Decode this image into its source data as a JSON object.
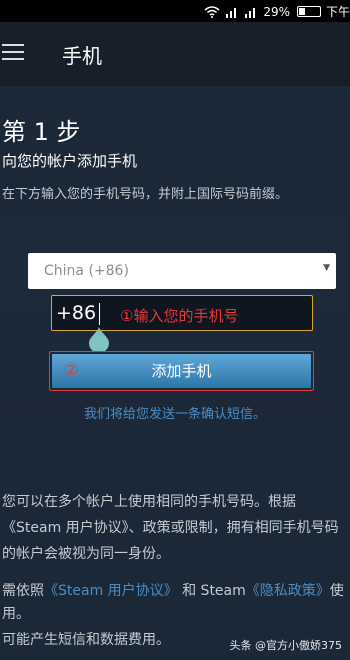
{
  "status_bar": {
    "battery_percent_label": "29%",
    "time_label": "下午",
    "wifi_icon": "wifi-icon",
    "signal_icon": "signal-icon",
    "battery_icon": "battery-icon"
  },
  "app_bar": {
    "menu_icon": "hamburger-menu-icon",
    "title": "手机"
  },
  "main": {
    "step_title": "第 1 步",
    "subtitle": "向您的帐户添加手机",
    "description": "在下方输入您的手机号码，并附上国际号码前缀。",
    "country_select": {
      "selected": "China (+86)"
    },
    "phone_input": {
      "prefix": "+86",
      "annotation": "①输入您的手机号"
    },
    "add_button": {
      "annotation_number": "②",
      "label": "添加手机"
    },
    "confirm_note": "我们将给您发送一条确认短信。",
    "info_paragraph": "您可以在多个帐户上使用相同的手机号码。根据《Steam 用户协议》、政策或限制，拥有相同手机号码的帐户会被视为同一身份。",
    "legal": {
      "prefix": "需依照",
      "agreement_link": "《Steam 用户协议》",
      "middle": "和 Steam",
      "privacy_link": "《隐私政策》",
      "suffix": "使用。"
    },
    "charges_note": "可能产生短信和数据费用。"
  },
  "watermark": "头条 @官方小傲娇375",
  "colors": {
    "background": "#1b2838",
    "app_bar": "#171f2a",
    "link": "#4c8dc5",
    "button_gradient_top": "#60a8d8",
    "button_gradient_bottom": "#2c75a7",
    "annotation_red": "#e53935",
    "input_border": "#d9a634"
  }
}
